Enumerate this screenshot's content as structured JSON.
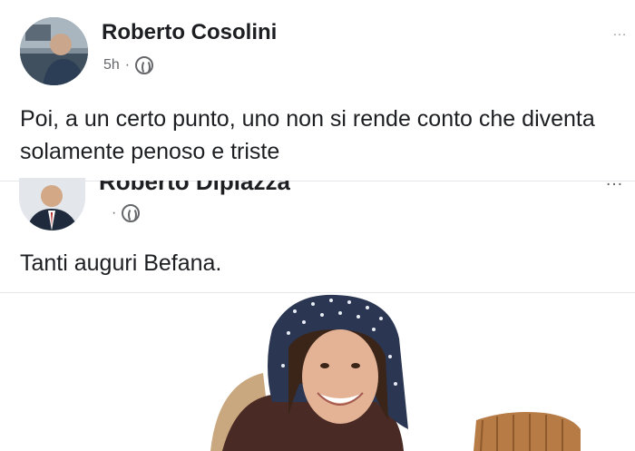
{
  "post1": {
    "author": "Roberto Cosolini",
    "meta_time": "5h",
    "privacy_icon": "globe-icon",
    "more_label": "…",
    "text": "Poi, a un certo punto, uno non si rende conto che diventa solamente penoso e triste"
  },
  "post2": {
    "author": "Roberto Dipiazza",
    "meta_time": "",
    "privacy_icon": "globe-icon",
    "more_label": "…",
    "text": "Tanti auguri Befana."
  }
}
